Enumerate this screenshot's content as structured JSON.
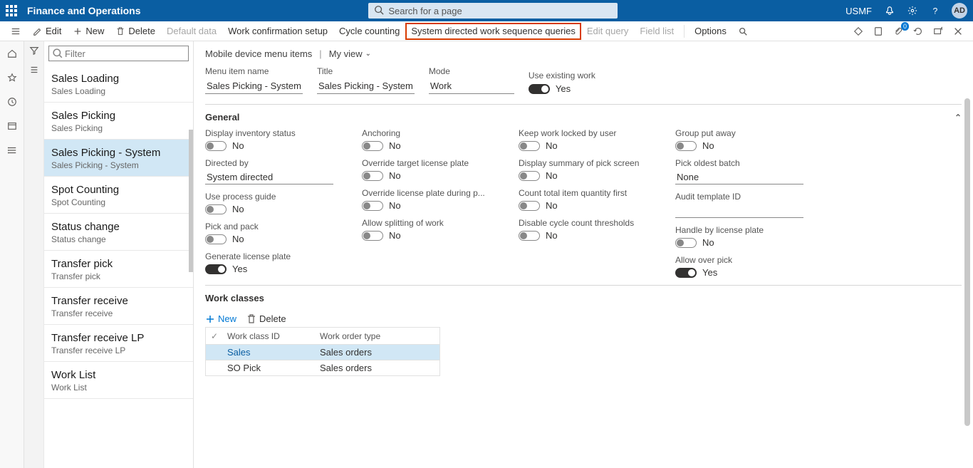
{
  "header": {
    "title": "Finance and Operations",
    "search_placeholder": "Search for a page",
    "company": "USMF",
    "avatar": "AD"
  },
  "actionbar": {
    "edit": "Edit",
    "new": "New",
    "delete": "Delete",
    "default_data": "Default data",
    "work_confirm": "Work confirmation setup",
    "cycle_counting": "Cycle counting",
    "sys_directed": "System directed work sequence queries",
    "edit_query": "Edit query",
    "field_list": "Field list",
    "options": "Options",
    "badge": "0"
  },
  "sidebar": {
    "filter_placeholder": "Filter",
    "items": [
      {
        "title": "Sales Loading",
        "sub": "Sales Loading"
      },
      {
        "title": "Sales Picking",
        "sub": "Sales Picking"
      },
      {
        "title": "Sales Picking - System",
        "sub": "Sales Picking - System",
        "selected": true
      },
      {
        "title": "Spot Counting",
        "sub": "Spot Counting"
      },
      {
        "title": "Status change",
        "sub": "Status change"
      },
      {
        "title": "Transfer pick",
        "sub": "Transfer pick"
      },
      {
        "title": "Transfer receive",
        "sub": "Transfer receive"
      },
      {
        "title": "Transfer receive LP",
        "sub": "Transfer receive LP"
      },
      {
        "title": "Work List",
        "sub": "Work List"
      }
    ]
  },
  "breadcrumb": {
    "page": "Mobile device menu items",
    "view": "My view"
  },
  "fields": {
    "menu_item_name": {
      "label": "Menu item name",
      "value": "Sales Picking - System"
    },
    "title": {
      "label": "Title",
      "value": "Sales Picking - System"
    },
    "mode": {
      "label": "Mode",
      "value": "Work"
    },
    "use_existing": {
      "label": "Use existing work",
      "value": "Yes",
      "on": true
    }
  },
  "general": {
    "heading": "General",
    "col1": [
      {
        "key": "display_inv_status",
        "label": "Display inventory status",
        "type": "toggle",
        "text": "No",
        "on": false
      },
      {
        "key": "directed_by",
        "label": "Directed by",
        "type": "input",
        "value": "System directed"
      },
      {
        "key": "use_process_guide",
        "label": "Use process guide",
        "type": "toggle",
        "text": "No",
        "on": false
      },
      {
        "key": "pick_and_pack",
        "label": "Pick and pack",
        "type": "toggle",
        "text": "No",
        "on": false
      },
      {
        "key": "generate_lp",
        "label": "Generate license plate",
        "type": "toggle",
        "text": "Yes",
        "on": true
      }
    ],
    "col2": [
      {
        "key": "anchoring",
        "label": "Anchoring",
        "type": "toggle",
        "text": "No",
        "on": false
      },
      {
        "key": "override_target_lp",
        "label": "Override target license plate",
        "type": "toggle",
        "text": "No",
        "on": false
      },
      {
        "key": "override_lp_put",
        "label": "Override license plate during p...",
        "type": "toggle",
        "text": "No",
        "on": false
      },
      {
        "key": "allow_split",
        "label": "Allow splitting of work",
        "type": "toggle",
        "text": "No",
        "on": false
      }
    ],
    "col3": [
      {
        "key": "keep_locked",
        "label": "Keep work locked by user",
        "type": "toggle",
        "text": "No",
        "on": false
      },
      {
        "key": "display_summary",
        "label": "Display summary of pick screen",
        "type": "toggle",
        "text": "No",
        "on": false
      },
      {
        "key": "count_total",
        "label": "Count total item quantity first",
        "type": "toggle",
        "text": "No",
        "on": false
      },
      {
        "key": "disable_cc",
        "label": "Disable cycle count thresholds",
        "type": "toggle",
        "text": "No",
        "on": false
      }
    ],
    "col4": [
      {
        "key": "group_put",
        "label": "Group put away",
        "type": "toggle",
        "text": "No",
        "on": false
      },
      {
        "key": "pick_oldest",
        "label": "Pick oldest batch",
        "type": "input",
        "value": "None"
      },
      {
        "key": "audit_template",
        "label": "Audit template ID",
        "type": "input",
        "value": ""
      },
      {
        "key": "handle_lp",
        "label": "Handle by license plate",
        "type": "toggle",
        "text": "No",
        "on": false
      },
      {
        "key": "allow_over_pick",
        "label": "Allow over pick",
        "type": "toggle",
        "text": "Yes",
        "on": true
      }
    ]
  },
  "workclasses": {
    "heading": "Work classes",
    "new": "New",
    "delete": "Delete",
    "headers": {
      "id": "Work class ID",
      "type": "Work order type"
    },
    "rows": [
      {
        "id": "Sales",
        "type": "Sales orders",
        "selected": true
      },
      {
        "id": "SO Pick",
        "type": "Sales orders",
        "selected": false
      }
    ]
  }
}
